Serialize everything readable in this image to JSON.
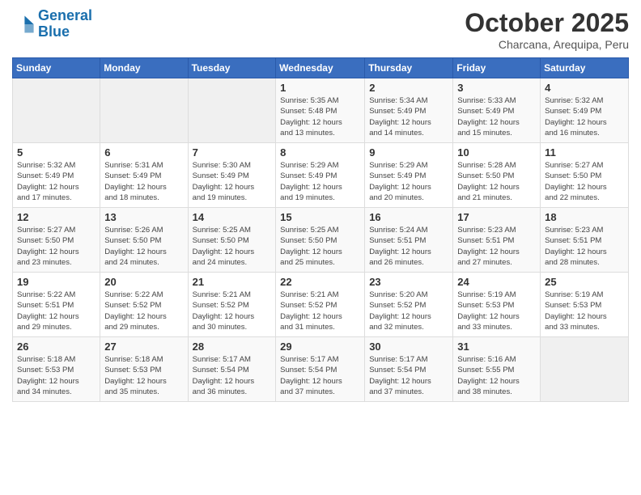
{
  "header": {
    "logo_line1": "General",
    "logo_line2": "Blue",
    "month_title": "October 2025",
    "location": "Charcana, Arequipa, Peru"
  },
  "weekdays": [
    "Sunday",
    "Monday",
    "Tuesday",
    "Wednesday",
    "Thursday",
    "Friday",
    "Saturday"
  ],
  "weeks": [
    [
      {
        "day": "",
        "info": ""
      },
      {
        "day": "",
        "info": ""
      },
      {
        "day": "",
        "info": ""
      },
      {
        "day": "1",
        "info": "Sunrise: 5:35 AM\nSunset: 5:48 PM\nDaylight: 12 hours\nand 13 minutes."
      },
      {
        "day": "2",
        "info": "Sunrise: 5:34 AM\nSunset: 5:49 PM\nDaylight: 12 hours\nand 14 minutes."
      },
      {
        "day": "3",
        "info": "Sunrise: 5:33 AM\nSunset: 5:49 PM\nDaylight: 12 hours\nand 15 minutes."
      },
      {
        "day": "4",
        "info": "Sunrise: 5:32 AM\nSunset: 5:49 PM\nDaylight: 12 hours\nand 16 minutes."
      }
    ],
    [
      {
        "day": "5",
        "info": "Sunrise: 5:32 AM\nSunset: 5:49 PM\nDaylight: 12 hours\nand 17 minutes."
      },
      {
        "day": "6",
        "info": "Sunrise: 5:31 AM\nSunset: 5:49 PM\nDaylight: 12 hours\nand 18 minutes."
      },
      {
        "day": "7",
        "info": "Sunrise: 5:30 AM\nSunset: 5:49 PM\nDaylight: 12 hours\nand 19 minutes."
      },
      {
        "day": "8",
        "info": "Sunrise: 5:29 AM\nSunset: 5:49 PM\nDaylight: 12 hours\nand 19 minutes."
      },
      {
        "day": "9",
        "info": "Sunrise: 5:29 AM\nSunset: 5:49 PM\nDaylight: 12 hours\nand 20 minutes."
      },
      {
        "day": "10",
        "info": "Sunrise: 5:28 AM\nSunset: 5:50 PM\nDaylight: 12 hours\nand 21 minutes."
      },
      {
        "day": "11",
        "info": "Sunrise: 5:27 AM\nSunset: 5:50 PM\nDaylight: 12 hours\nand 22 minutes."
      }
    ],
    [
      {
        "day": "12",
        "info": "Sunrise: 5:27 AM\nSunset: 5:50 PM\nDaylight: 12 hours\nand 23 minutes."
      },
      {
        "day": "13",
        "info": "Sunrise: 5:26 AM\nSunset: 5:50 PM\nDaylight: 12 hours\nand 24 minutes."
      },
      {
        "day": "14",
        "info": "Sunrise: 5:25 AM\nSunset: 5:50 PM\nDaylight: 12 hours\nand 24 minutes."
      },
      {
        "day": "15",
        "info": "Sunrise: 5:25 AM\nSunset: 5:50 PM\nDaylight: 12 hours\nand 25 minutes."
      },
      {
        "day": "16",
        "info": "Sunrise: 5:24 AM\nSunset: 5:51 PM\nDaylight: 12 hours\nand 26 minutes."
      },
      {
        "day": "17",
        "info": "Sunrise: 5:23 AM\nSunset: 5:51 PM\nDaylight: 12 hours\nand 27 minutes."
      },
      {
        "day": "18",
        "info": "Sunrise: 5:23 AM\nSunset: 5:51 PM\nDaylight: 12 hours\nand 28 minutes."
      }
    ],
    [
      {
        "day": "19",
        "info": "Sunrise: 5:22 AM\nSunset: 5:51 PM\nDaylight: 12 hours\nand 29 minutes."
      },
      {
        "day": "20",
        "info": "Sunrise: 5:22 AM\nSunset: 5:52 PM\nDaylight: 12 hours\nand 29 minutes."
      },
      {
        "day": "21",
        "info": "Sunrise: 5:21 AM\nSunset: 5:52 PM\nDaylight: 12 hours\nand 30 minutes."
      },
      {
        "day": "22",
        "info": "Sunrise: 5:21 AM\nSunset: 5:52 PM\nDaylight: 12 hours\nand 31 minutes."
      },
      {
        "day": "23",
        "info": "Sunrise: 5:20 AM\nSunset: 5:52 PM\nDaylight: 12 hours\nand 32 minutes."
      },
      {
        "day": "24",
        "info": "Sunrise: 5:19 AM\nSunset: 5:53 PM\nDaylight: 12 hours\nand 33 minutes."
      },
      {
        "day": "25",
        "info": "Sunrise: 5:19 AM\nSunset: 5:53 PM\nDaylight: 12 hours\nand 33 minutes."
      }
    ],
    [
      {
        "day": "26",
        "info": "Sunrise: 5:18 AM\nSunset: 5:53 PM\nDaylight: 12 hours\nand 34 minutes."
      },
      {
        "day": "27",
        "info": "Sunrise: 5:18 AM\nSunset: 5:53 PM\nDaylight: 12 hours\nand 35 minutes."
      },
      {
        "day": "28",
        "info": "Sunrise: 5:17 AM\nSunset: 5:54 PM\nDaylight: 12 hours\nand 36 minutes."
      },
      {
        "day": "29",
        "info": "Sunrise: 5:17 AM\nSunset: 5:54 PM\nDaylight: 12 hours\nand 37 minutes."
      },
      {
        "day": "30",
        "info": "Sunrise: 5:17 AM\nSunset: 5:54 PM\nDaylight: 12 hours\nand 37 minutes."
      },
      {
        "day": "31",
        "info": "Sunrise: 5:16 AM\nSunset: 5:55 PM\nDaylight: 12 hours\nand 38 minutes."
      },
      {
        "day": "",
        "info": ""
      }
    ]
  ]
}
